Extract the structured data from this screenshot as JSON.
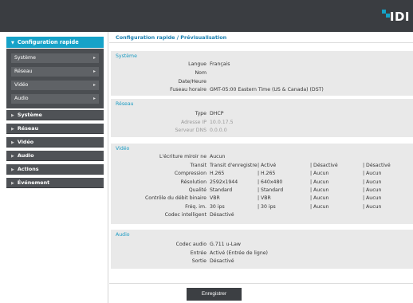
{
  "brand": {
    "logo_text": "IDI",
    "accent": "#14a3c7"
  },
  "sidebar": {
    "active": {
      "label": "Configuration rapide"
    },
    "subitems": [
      {
        "label": "Système"
      },
      {
        "label": "Réseau"
      },
      {
        "label": "Vidéo"
      },
      {
        "label": "Audio"
      }
    ],
    "items": [
      {
        "label": "Système"
      },
      {
        "label": "Réseau"
      },
      {
        "label": "Vidéo"
      },
      {
        "label": "Audio"
      },
      {
        "label": "Actions"
      },
      {
        "label": "Événement"
      }
    ]
  },
  "main": {
    "title": "Configuration rapide / Prévisualisation",
    "systeme": {
      "title": "Système",
      "rows": [
        {
          "label": "Langue",
          "value": "Français"
        },
        {
          "label": "Nom",
          "value": ""
        },
        {
          "label": "Date/Heure",
          "value": ""
        },
        {
          "label": "Fuseau horaire",
          "value": "GMT-05:00 Eastern Time (US & Canada) (DST)"
        }
      ]
    },
    "reseau": {
      "title": "Réseau",
      "rows": [
        {
          "label": "Type",
          "value": "DHCP"
        },
        {
          "label": "Adresse IP",
          "value": "10.0.17.5"
        },
        {
          "label": "Serveur DNS",
          "value": "0.0.0.0"
        }
      ]
    },
    "video": {
      "title": "Vidéo",
      "mirror_label": "L'écriture miroir ne",
      "mirror_value": "Aucun",
      "rows": [
        {
          "label": "Transit",
          "c1": "Transit d'enregistrem",
          "c2": "| Activé",
          "c3": "| Désactivé",
          "c4": "| Désactivé"
        },
        {
          "label": "Compression",
          "c1": "H.265",
          "c2": "| H.265",
          "c3": "| Aucun",
          "c4": "| Aucun"
        },
        {
          "label": "Résolution",
          "c1": "2592x1944",
          "c2": "| 640x480",
          "c3": "| Aucun",
          "c4": "| Aucun"
        },
        {
          "label": "Qualité",
          "c1": "Standard",
          "c2": "| Standard",
          "c3": "| Aucun",
          "c4": "| Aucun"
        },
        {
          "label": "Contrôle du débit binaire",
          "c1": "VBR",
          "c2": "| VBR",
          "c3": "| Aucun",
          "c4": "| Aucun"
        },
        {
          "label": "Fréq. im.",
          "c1": "30 ips",
          "c2": "| 30 ips",
          "c3": "| Aucun",
          "c4": "| Aucun"
        }
      ],
      "codec_label": "Codec intelligent",
      "codec_value": "Désactivé"
    },
    "audio": {
      "title": "Audio",
      "rows": [
        {
          "label": "Codec audio",
          "value": "G.711 u-Law"
        },
        {
          "label": "Entrée",
          "value": "Activé (Entrée de ligne)"
        },
        {
          "label": "Sortie",
          "value": "Désactivé"
        }
      ]
    }
  },
  "footer": {
    "save_label": "Enregistrer"
  }
}
